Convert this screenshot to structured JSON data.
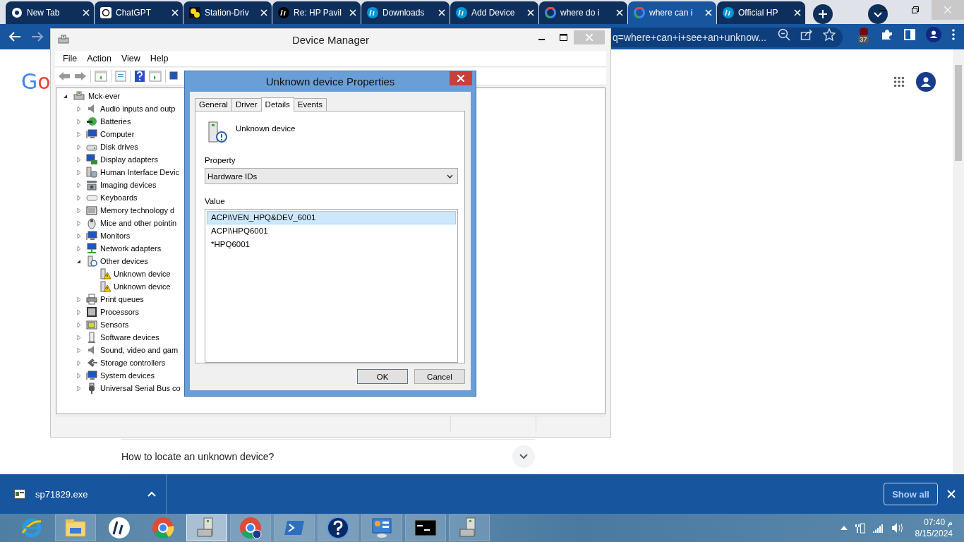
{
  "browser": {
    "tabs": [
      {
        "title": "New Tab",
        "kind": "chrome",
        "selected": false
      },
      {
        "title": "ChatGPT",
        "kind": "openai",
        "selected": false
      },
      {
        "title": "Station-Driv",
        "kind": "sd",
        "selected": false
      },
      {
        "title": "Re: HP Pavil",
        "kind": "hp-dark",
        "selected": false
      },
      {
        "title": "Downloads",
        "kind": "hp",
        "selected": false
      },
      {
        "title": "Add Device",
        "kind": "hp",
        "selected": false
      },
      {
        "title": "where do i",
        "kind": "google",
        "selected": false
      },
      {
        "title": "where can i",
        "kind": "google",
        "selected": true
      },
      {
        "title": "Official HP",
        "kind": "hp",
        "selected": false
      }
    ],
    "address": "q=where+can+i+see+an+unknow...",
    "extension_badge": "37"
  },
  "page": {
    "logo": [
      {
        "text": "G",
        "color": "#4285f4"
      },
      {
        "text": "o",
        "color": "#ea4335"
      }
    ],
    "question": "How to locate an unknown device?"
  },
  "download_bar": {
    "file": "sp71829.exe",
    "show_all": "Show all"
  },
  "device_manager": {
    "title": "Device Manager",
    "menu": [
      "File",
      "Action",
      "View",
      "Help"
    ],
    "tree": [
      {
        "label": "Mck-ever",
        "kind": "computer",
        "expanded": true,
        "children": [
          {
            "label": "Audio inputs and outp",
            "kind": "speaker",
            "expanded": false
          },
          {
            "label": "Batteries",
            "kind": "battery",
            "expanded": false
          },
          {
            "label": "Computer",
            "kind": "monitor",
            "expanded": false
          },
          {
            "label": "Disk drives",
            "kind": "disk",
            "expanded": false
          },
          {
            "label": "Display adapters",
            "kind": "display",
            "expanded": false
          },
          {
            "label": "Human Interface Devic",
            "kind": "hid",
            "expanded": false
          },
          {
            "label": "Imaging devices",
            "kind": "camera",
            "expanded": false
          },
          {
            "label": "Keyboards",
            "kind": "keyboard",
            "expanded": false
          },
          {
            "label": "Memory technology d",
            "kind": "memory",
            "expanded": false
          },
          {
            "label": "Mice and other pointin",
            "kind": "mouse",
            "expanded": false
          },
          {
            "label": "Monitors",
            "kind": "monitor",
            "expanded": false
          },
          {
            "label": "Network adapters",
            "kind": "network",
            "expanded": false
          },
          {
            "label": "Other devices",
            "kind": "unknown",
            "expanded": true,
            "children": [
              {
                "label": "Unknown device",
                "kind": "warning"
              },
              {
                "label": "Unknown device",
                "kind": "warning"
              }
            ]
          },
          {
            "label": "Print queues",
            "kind": "printer",
            "expanded": false
          },
          {
            "label": "Processors",
            "kind": "chip",
            "expanded": false
          },
          {
            "label": "Sensors",
            "kind": "sensor",
            "expanded": false
          },
          {
            "label": "Software devices",
            "kind": "device",
            "expanded": false
          },
          {
            "label": "Sound, video and gam",
            "kind": "speaker",
            "expanded": false
          },
          {
            "label": "Storage controllers",
            "kind": "storage",
            "expanded": false
          },
          {
            "label": "System devices",
            "kind": "monitor",
            "expanded": false
          },
          {
            "label": "Universal Serial Bus co",
            "kind": "usb",
            "expanded": false
          }
        ]
      }
    ]
  },
  "dialog": {
    "title": "Unknown device Properties",
    "tabs": [
      {
        "label": "General",
        "selected": false
      },
      {
        "label": "Driver",
        "selected": false
      },
      {
        "label": "Details",
        "selected": true
      },
      {
        "label": "Events",
        "selected": false
      }
    ],
    "device_name": "Unknown device",
    "property_label": "Property",
    "property_value": "Hardware IDs",
    "value_label": "Value",
    "values": [
      {
        "text": "ACPI\\VEN_HPQ&DEV_6001",
        "selected": true
      },
      {
        "text": "ACPI\\HPQ6001",
        "selected": false
      },
      {
        "text": "*HPQ6001",
        "selected": false
      }
    ],
    "buttons": [
      "OK",
      "Cancel"
    ]
  },
  "taskbar": {
    "apps": [
      {
        "kind": "ie",
        "running": false,
        "selected": false
      },
      {
        "kind": "explorer",
        "running": true,
        "selected": false
      },
      {
        "kind": "hp",
        "running": false,
        "selected": false
      },
      {
        "kind": "chrome",
        "running": false,
        "selected": false
      },
      {
        "kind": "devmgr",
        "running": true,
        "selected": true
      },
      {
        "kind": "chrome-profile",
        "running": true,
        "selected": false
      },
      {
        "kind": "powershell",
        "running": true,
        "selected": false
      },
      {
        "kind": "help",
        "running": true,
        "selected": false
      },
      {
        "kind": "control-panel",
        "running": true,
        "selected": false
      },
      {
        "kind": "cmd",
        "running": true,
        "selected": false
      },
      {
        "kind": "devmgr",
        "running": true,
        "selected": false
      }
    ],
    "time": "07:40 م",
    "date": "8/15/2024"
  }
}
